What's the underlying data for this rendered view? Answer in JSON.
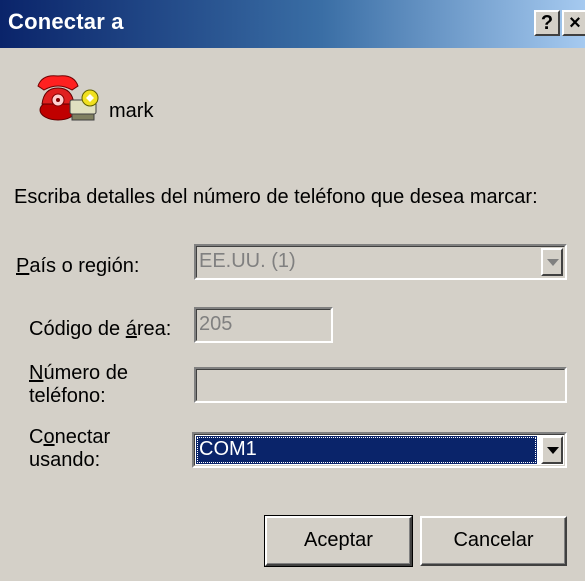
{
  "window": {
    "title": "Conectar a",
    "help_label": "?",
    "close_label": "×"
  },
  "connection": {
    "name": "mark",
    "icon": "phone-icon"
  },
  "instructions": "Escriba detalles del número de teléfono que desea marcar:",
  "country": {
    "label_u": "P",
    "label_rest": "aís o región:",
    "value": "EE.UU. (1)"
  },
  "area_code": {
    "label_pre": "Código de ",
    "label_u": "á",
    "label_post": "rea:",
    "value": "205"
  },
  "phone_number": {
    "label_u": "N",
    "label_line1_rest": "úmero de",
    "label_line2": "teléfono:",
    "value": ""
  },
  "connect_using": {
    "label_pre": "C",
    "label_u": "o",
    "label_line1_rest": "nectar",
    "label_line2": "usando:",
    "value": "COM1"
  },
  "buttons": {
    "ok": "Aceptar",
    "cancel": "Cancelar"
  },
  "colors": {
    "title_start": "#0a246a",
    "title_end": "#a6caf0",
    "face": "#d4d0c8",
    "selection": "#0a246a"
  }
}
